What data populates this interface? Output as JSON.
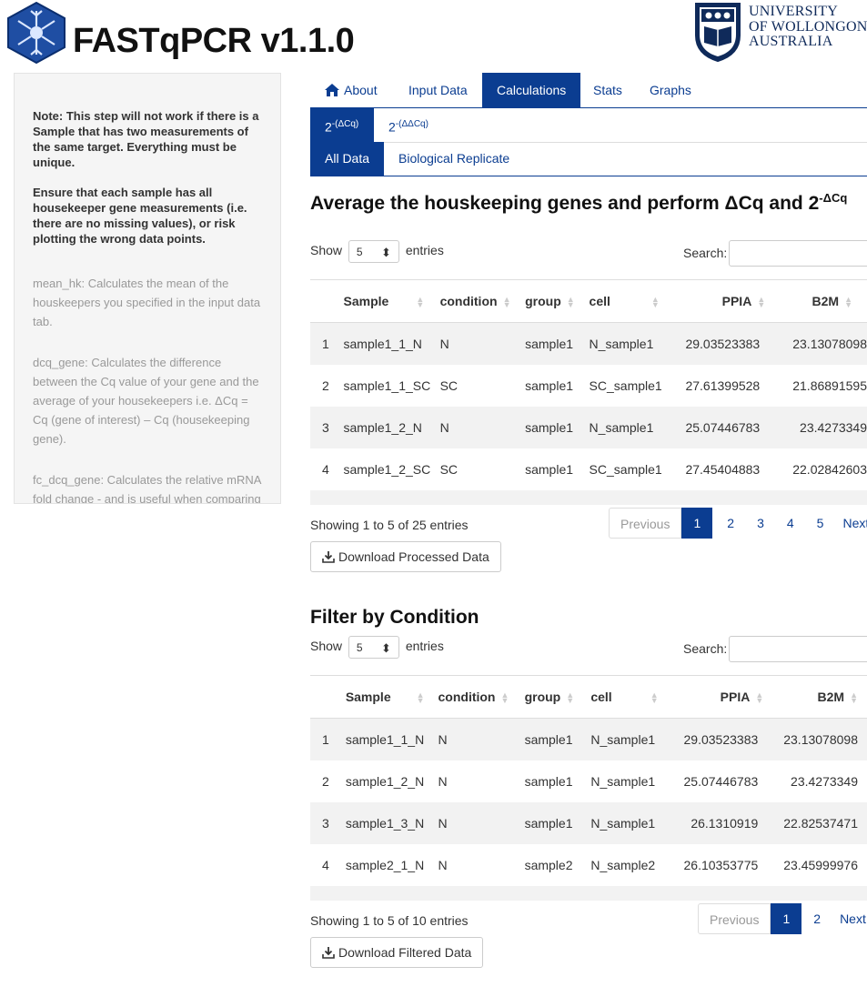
{
  "header": {
    "app_title": "FASTqPCR v1.1.0",
    "uni_lines": [
      "UNIVERSITY",
      "OF WOLLONGONG",
      "AUSTRALIA"
    ],
    "brand_color": "#0b3d91"
  },
  "sidebar": {
    "note1": "Note: This step will not work if there is a Sample that has two measurements of the same target. Everything must be unique.",
    "note2": "Ensure that each sample has all housekeeper gene measurements (i.e. there are no missing values), or risk plotting the wrong data points.",
    "help1": "mean_hk: Calculates the mean of the houskeepers you specified in the input data tab.",
    "help2": "dcq_gene: Calculates the difference between the Cq value of your gene and the average of your housekeepers i.e. ΔCq = Cq (gene of interest) – Cq (housekeeping gene).",
    "help3": "fc_dcq_gene: Calculates the relative mRNA fold change - and is useful when comparing to controls."
  },
  "tabs": {
    "about": "About",
    "input": "Input Data",
    "calc": "Calculations",
    "stats": "Stats",
    "graphs": "Graphs"
  },
  "subtabs": {
    "dcq_base": "2",
    "dcq_exp": "-(ΔCq)",
    "ddcq_base": "2",
    "ddcq_exp": "-(ΔΔCq)",
    "all": "All Data",
    "bio": "Biological Replicate"
  },
  "section1": {
    "title": "Average the houskeeping genes and perform ΔCq and 2",
    "title_sup": "-ΔCq",
    "show": "Show",
    "length": "5",
    "entries": "entries",
    "search": "Search:",
    "columns": [
      "",
      "Sample",
      "condition",
      "group",
      "cell",
      "PPIA",
      "B2M"
    ],
    "rows": [
      [
        "1",
        "sample1_1_N",
        "N",
        "sample1",
        "N_sample1",
        "29.03523383",
        "23.13078098"
      ],
      [
        "2",
        "sample1_1_SC",
        "SC",
        "sample1",
        "SC_sample1",
        "27.61399528",
        "21.86891595"
      ],
      [
        "3",
        "sample1_2_N",
        "N",
        "sample1",
        "N_sample1",
        "25.07446783",
        "23.4273349"
      ],
      [
        "4",
        "sample1_2_SC",
        "SC",
        "sample1",
        "SC_sample1",
        "27.45404883",
        "22.02842603"
      ]
    ],
    "info": "Showing 1 to 5 of 25 entries",
    "previous": "Previous",
    "pages": [
      "1",
      "2",
      "3",
      "4",
      "5"
    ],
    "next": "Next",
    "download": "Download Processed Data"
  },
  "section2": {
    "title": "Filter by Condition",
    "show": "Show",
    "length": "5",
    "entries": "entries",
    "search": "Search:",
    "columns": [
      "",
      "Sample",
      "condition",
      "group",
      "cell",
      "PPIA",
      "B2M"
    ],
    "rows": [
      [
        "1",
        "sample1_1_N",
        "N",
        "sample1",
        "N_sample1",
        "29.03523383",
        "23.13078098"
      ],
      [
        "2",
        "sample1_2_N",
        "N",
        "sample1",
        "N_sample1",
        "25.07446783",
        "23.4273349"
      ],
      [
        "3",
        "sample1_3_N",
        "N",
        "sample1",
        "N_sample1",
        "26.1310919",
        "22.82537471"
      ],
      [
        "4",
        "sample2_1_N",
        "N",
        "sample2",
        "N_sample2",
        "26.10353775",
        "23.45999976"
      ]
    ],
    "info": "Showing 1 to 5 of 10 entries",
    "previous": "Previous",
    "pages": [
      "1",
      "2"
    ],
    "next": "Next",
    "download": "Download Filtered Data"
  }
}
